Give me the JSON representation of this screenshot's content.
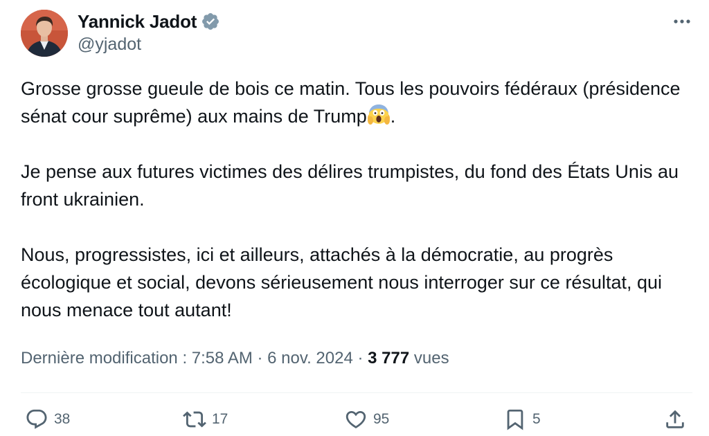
{
  "author": {
    "name": "Yannick Jadot",
    "handle": "@yjadot",
    "verified": true
  },
  "tweet": {
    "paragraphs": [
      {
        "text": "Grosse grosse gueule de bois ce matin. Tous les pouvoirs fédéraux (présidence sénat cour suprême) aux mains de Trump",
        "emoji": "face-screaming-in-fear",
        "suffix": "."
      },
      {
        "text": "Je pense aux futures victimes des délires trumpistes, du fond des États Unis au front ukrainien."
      },
      {
        "text": "Nous, progressistes, ici et ailleurs, attachés à la démocratie, au progrès écologique et social, devons sérieusement nous interroger sur ce résultat, qui nous menace tout autant!"
      }
    ]
  },
  "meta": {
    "edited_label": "Dernière modification : 7:58 AM · 6 nov. 2024 · ",
    "views_count": "3 777",
    "views_label": " vues"
  },
  "actions": {
    "replies": "38",
    "reposts": "17",
    "likes": "95",
    "bookmarks": "5"
  },
  "icons": {
    "verified": "verified-badge-icon",
    "more": "more-dots-icon",
    "reply": "reply-bubble-icon",
    "repost": "repost-arrows-icon",
    "like": "heart-icon",
    "bookmark": "bookmark-icon",
    "share": "share-upload-icon"
  },
  "colors": {
    "text": "#0f1419",
    "secondary": "#536471",
    "verified_badge": "#829aab",
    "divider": "#eff3f4",
    "avatar_bg": "#c8553a"
  }
}
